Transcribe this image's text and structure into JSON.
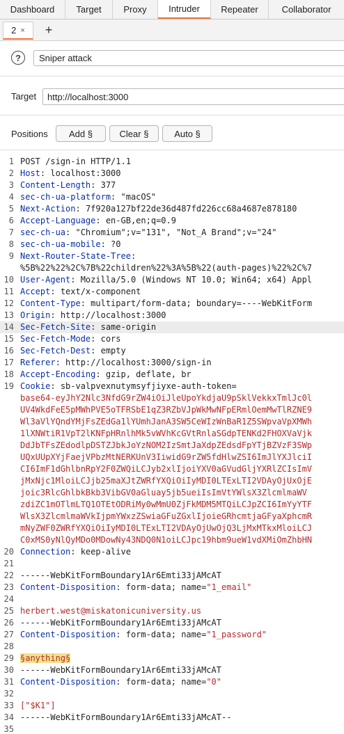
{
  "nav_tabs": [
    "Dashboard",
    "Target",
    "Proxy",
    "Intruder",
    "Repeater",
    "Collaborator"
  ],
  "active_nav": "Intruder",
  "subtab": {
    "label": "2",
    "close": "×",
    "add": "+"
  },
  "attack": {
    "help": "?",
    "type": "Sniper attack"
  },
  "target": {
    "label": "Target",
    "value": "http://localhost:3000"
  },
  "positions": {
    "label": "Positions",
    "add": "Add §",
    "clear": "Clear §",
    "auto": "Auto §"
  },
  "request_lines": [
    {
      "n": "1",
      "t": "POST /sign-in HTTP/1.1"
    },
    {
      "n": "2",
      "k": "Host",
      "v": "localhost:3000"
    },
    {
      "n": "3",
      "k": "Content-Length",
      "v": "377"
    },
    {
      "n": "4",
      "k": "sec-ch-ua-platform",
      "v": "\"macOS\""
    },
    {
      "n": "5",
      "k": "Next-Action",
      "v": "7f920a127bf22de36d487fd226cc68a4687e878180"
    },
    {
      "n": "6",
      "k": "Accept-Language",
      "v": "en-GB,en;q=0.9"
    },
    {
      "n": "7",
      "k": "sec-ch-ua",
      "v": "\"Chromium\";v=\"131\", \"Not_A Brand\";v=\"24\""
    },
    {
      "n": "8",
      "k": "sec-ch-ua-mobile",
      "v": "?0"
    },
    {
      "n": "9",
      "k": "Next-Router-State-Tree",
      "v": ""
    },
    {
      "n": "",
      "t": "%5B%22%22%2C%7B%22children%22%3A%5B%22(auth-pages)%22%2C%7"
    },
    {
      "n": "10",
      "k": "User-Agent",
      "v": "Mozilla/5.0 (Windows NT 10.0; Win64; x64) Appl"
    },
    {
      "n": "11",
      "k": "Accept",
      "v": "text/x-component"
    },
    {
      "n": "12",
      "k": "Content-Type",
      "v": "multipart/form-data; boundary=----WebKitForm"
    },
    {
      "n": "13",
      "k": "Origin",
      "v": "http://localhost:3000"
    },
    {
      "n": "14",
      "k": "Sec-Fetch-Site",
      "v": "same-origin",
      "hl": true
    },
    {
      "n": "15",
      "k": "Sec-Fetch-Mode",
      "v": "cors"
    },
    {
      "n": "16",
      "k": "Sec-Fetch-Dest",
      "v": "empty"
    },
    {
      "n": "17",
      "k": "Referer",
      "v": "http://localhost:3000/sign-in"
    },
    {
      "n": "18",
      "k": "Accept-Encoding",
      "v": "gzip, deflate, br"
    },
    {
      "n": "19",
      "k": "Cookie",
      "v": "sb-valpvexnutymsyfjiyxe-auth-token="
    },
    {
      "n": "",
      "r": "base64-eyJhY2Nlc3NfdG9rZW4iOiJleUpoYkdjaU9pSklVekkxTmlJc0l"
    },
    {
      "n": "",
      "r": "UV4WkdFeE5pMWhPVE5oTFRSbE1qZ3RZbVJpWkMwNFpERmlOemMwTlRZNE9"
    },
    {
      "n": "",
      "r": "Wl3aVlYQndYMjFsZEdGa1lYUmhJanA3SW5CeWIzWnBaR1Z5SWpvaVpXMWh"
    },
    {
      "n": "",
      "r": "1lXNWtiR1VpT2lKNFpHRnlhMk5vWVhKcGVtRnlaSGdpTENKd2FHOXVaVjk"
    },
    {
      "n": "",
      "r": "DdJbTFsZEdodlpDSTZJbkJoYzNOM2IzSmtJaXdpZEdsdFpYTjBZVzF3SWp"
    },
    {
      "n": "",
      "r": "UQxUUpXYjFaejVPbzMtNERKUnV3IiwidG9rZW5fdHlwZSI6ImJlYXJlciI"
    },
    {
      "n": "",
      "r": "CI6ImF1dGhlbnRpY2F0ZWQiLCJyb2xlIjoiYXV0aGVudGljYXRlZCIsImV"
    },
    {
      "n": "",
      "r": "jMxNjc1MloiLCJjb25maXJtZWRfYXQiOiIyMDI0LTExLTI2VDAyOjUxOjE"
    },
    {
      "n": "",
      "r": "joic3RlcGhlbkBkb3VibGV0aGluay5jb5ueiIsImVtYWlsX3ZlcmlmaWV"
    },
    {
      "n": "",
      "r": "zdiZC1mOTlmLTQ1OTEtODRiMy0wMmU0ZjFkMDM5MTQiLCJpZCI6ImYyYTF"
    },
    {
      "n": "",
      "r": "WlsX3ZlcmlmaWVkIjpmYWxzZSwiaGFuZGxlIjoieGRhcmtjaGFyaXphcmR"
    },
    {
      "n": "",
      "r": "mNyZWF0ZWRfYXQiOiIyMDI0LTExLTI2VDAyOjUwOjQ3LjMxMTkxMloiLCJ"
    },
    {
      "n": "",
      "r": "C0xMS0yNlQyMDo0MDowNy43NDQ0N1oiLCJpc19hbm9ueW1vdXMiOmZhbHN"
    },
    {
      "n": "20",
      "k": "Connection",
      "v": "keep-alive"
    },
    {
      "n": "21",
      "t": ""
    },
    {
      "n": "22",
      "t": "------WebKitFormBoundary1Ar6Emti33jAMcAT"
    },
    {
      "n": "23",
      "k": "Content-Disposition",
      "v": "form-data; name=",
      "q": "\"1_email\""
    },
    {
      "n": "24",
      "t": ""
    },
    {
      "n": "25",
      "r": "herbert.west@miskatonicuniversity.us"
    },
    {
      "n": "26",
      "t": "------WebKitFormBoundary1Ar6Emti33jAMcAT"
    },
    {
      "n": "27",
      "k": "Content-Disposition",
      "v": "form-data; name=",
      "q": "\"1_password\""
    },
    {
      "n": "28",
      "t": ""
    },
    {
      "n": "29",
      "p": "§anything§"
    },
    {
      "n": "30",
      "t": "------WebKitFormBoundary1Ar6Emti33jAMcAT"
    },
    {
      "n": "31",
      "k": "Content-Disposition",
      "v": "form-data; name=",
      "q": "\"0\""
    },
    {
      "n": "32",
      "t": ""
    },
    {
      "n": "33",
      "r": "[\"$K1\"]"
    },
    {
      "n": "34",
      "t": "------WebKitFormBoundary1Ar6Emti33jAMcAT--"
    },
    {
      "n": "35",
      "t": ""
    }
  ]
}
